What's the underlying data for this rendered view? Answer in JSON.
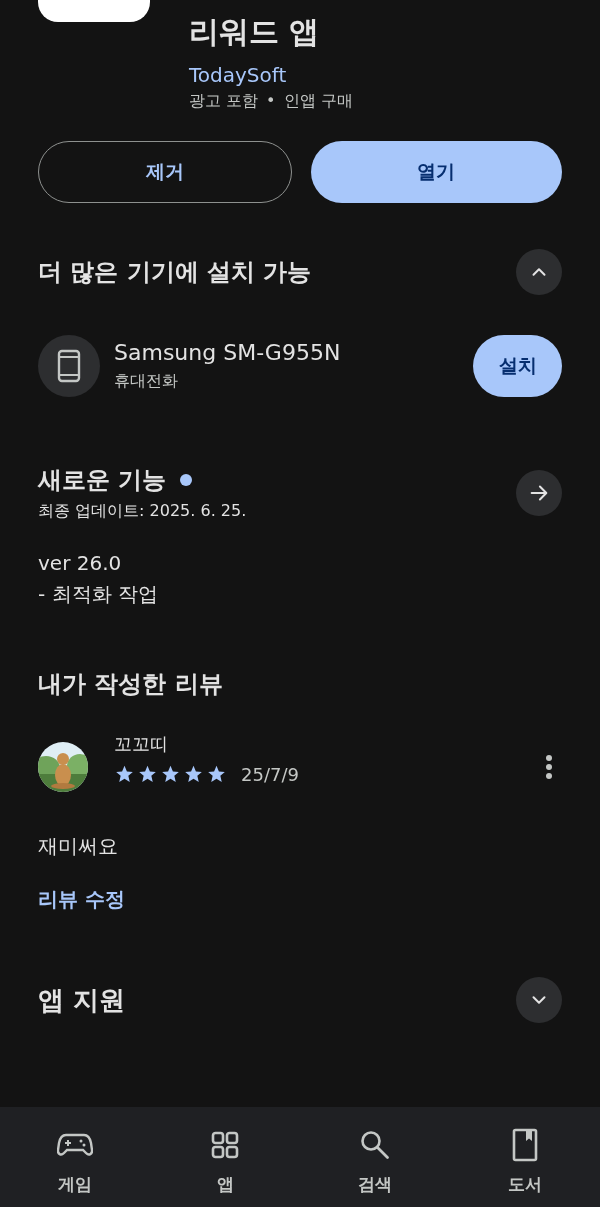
{
  "app": {
    "title": "리워드 앱",
    "developer": "TodaySoft",
    "tags": [
      "광고 포함",
      "인앱 구매"
    ],
    "separator": "•"
  },
  "actions": [
    {
      "label": "제거",
      "kind": "outlined"
    },
    {
      "label": "열기",
      "kind": "filled"
    }
  ],
  "devices_section": {
    "title": "더 많은 기기에 설치 가능",
    "expanded": true,
    "devices": [
      {
        "name": "Samsung SM-G955N",
        "type": "휴대전화",
        "action": "설치"
      }
    ]
  },
  "whats_new": {
    "title": "새로운 기능",
    "new": true,
    "updated": "최종 업데이트: 2025. 6. 25.",
    "lines": [
      "ver 26.0",
      "- 최적화 작업"
    ]
  },
  "my_review": {
    "title": "내가 작성한 리뷰",
    "author": "꼬꼬띠",
    "stars": 5,
    "date": "25/7/9",
    "text": "재미써요",
    "edit_link": "리뷰 수정"
  },
  "sections": [
    {
      "title": "앱 지원",
      "kind": "expand",
      "expanded": false
    }
  ],
  "bottom_nav": [
    {
      "label": "게임",
      "kind": "game",
      "selected": false
    },
    {
      "label": "앱",
      "kind": "apps",
      "selected": false
    },
    {
      "label": "검색",
      "kind": "search",
      "selected": false
    },
    {
      "label": "도서",
      "kind": "book",
      "selected": false
    }
  ]
}
